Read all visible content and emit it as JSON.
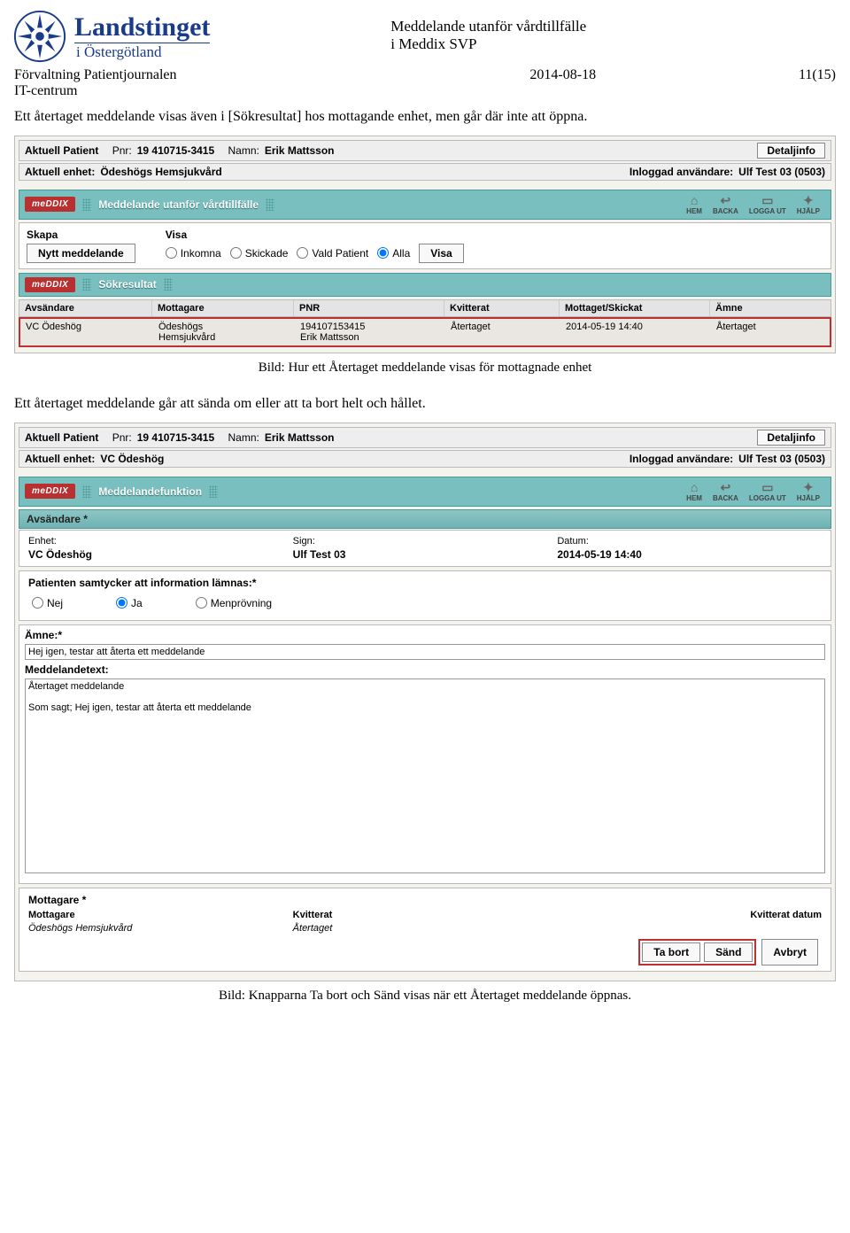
{
  "brand": {
    "main": "Landstinget",
    "sub": "i Östergötland"
  },
  "doc": {
    "title_l1": "Meddelande utanför vårdtillfälle",
    "title_l2": "i Meddix SVP",
    "org_l1": "Förvaltning Patientjournalen",
    "org_l2": "IT-centrum",
    "date": "2014-08-18",
    "page": "11(15)",
    "para1": "Ett återtaget meddelande visas även i [Sökresultat] hos mottagande enhet, men går där inte att öppna.",
    "caption1": "Bild: Hur ett Återtaget meddelande visas för mottagnade enhet",
    "para2": "Ett återtaget meddelande går att sända om eller att ta bort helt och hållet.",
    "caption2": "Bild: Knapparna Ta bort och Sänd visas när ett Återtaget meddelande öppnas."
  },
  "sc1": {
    "patient_lbl": "Aktuell Patient",
    "pnr_lbl": "Pnr:",
    "pnr": "19 410715-3415",
    "namn_lbl": "Namn:",
    "namn": "Erik Mattsson",
    "detaljinfo": "Detaljinfo",
    "enhet_lbl": "Aktuell enhet:",
    "enhet": "Ödeshögs Hemsjukvård",
    "user_lbl": "Inloggad användare:",
    "user": "Ulf Test 03 (0503)",
    "teal_title": "Meddelande utanför vårdtillfälle",
    "nav": {
      "hem": "HEM",
      "backa": "BACKA",
      "logga": "LOGGA UT",
      "hjalp": "HJÄLP"
    },
    "skapa": "Skapa",
    "nytt": "Nytt meddelande",
    "visa_h": "Visa",
    "r_ink": "Inkomna",
    "r_ski": "Skickade",
    "r_vp": "Vald Patient",
    "r_alla": "Alla",
    "visa_btn": "Visa",
    "sok_title": "Sökresultat",
    "cols": {
      "avs": "Avsändare",
      "mot": "Mottagare",
      "pnr": "PNR",
      "kvit": "Kvitterat",
      "motsk": "Mottaget/Skickat",
      "amne": "Ämne"
    },
    "row": {
      "avs": "VC Ödeshög",
      "mot_l1": "Ödeshögs",
      "mot_l2": "Hemsjukvård",
      "pnr_l1": "194107153415",
      "pnr_l2": "Erik Mattsson",
      "kvit": "Återtaget",
      "motsk": "2014-05-19 14:40",
      "amne": "Återtaget"
    }
  },
  "sc2": {
    "patient_lbl": "Aktuell Patient",
    "pnr_lbl": "Pnr:",
    "pnr": "19 410715-3415",
    "namn_lbl": "Namn:",
    "namn": "Erik Mattsson",
    "detaljinfo": "Detaljinfo",
    "enhet_lbl": "Aktuell enhet:",
    "enhet": "VC Ödeshög",
    "user_lbl": "Inloggad användare:",
    "user": "Ulf Test 03 (0503)",
    "teal_title": "Meddelandefunktion",
    "nav": {
      "hem": "HEM",
      "backa": "BACKA",
      "logga": "LOGGA UT",
      "hjalp": "HJÄLP"
    },
    "avs_h": "Avsändare *",
    "enhet_small": "Enhet:",
    "enhet_val": "VC Ödeshög",
    "sign_lbl": "Sign:",
    "sign_val": "Ulf Test 03",
    "datum_lbl": "Datum:",
    "datum_val": "2014-05-19 14:40",
    "consent_lbl": "Patienten samtycker att information lämnas:*",
    "r_nej": "Nej",
    "r_ja": "Ja",
    "r_men": "Menprövning",
    "amne_lbl": "Ämne:*",
    "amne_val": "Hej igen, testar att återta ett meddelande",
    "msg_lbl": "Meddelandetext:",
    "msg_val": "Återtaget meddelande\n\nSom sagt; Hej igen, testar att återta ett meddelande",
    "mot_h": "Mottagare *",
    "mot_col_mot": "Mottagare",
    "mot_col_kvit": "Kvitterat",
    "mot_col_date": "Kvitterat datum",
    "mot_val": "Ödeshögs Hemsjukvård",
    "kvit_val": "Återtaget",
    "btn_tabort": "Ta bort",
    "btn_sand": "Sänd",
    "btn_avbryt": "Avbryt"
  }
}
